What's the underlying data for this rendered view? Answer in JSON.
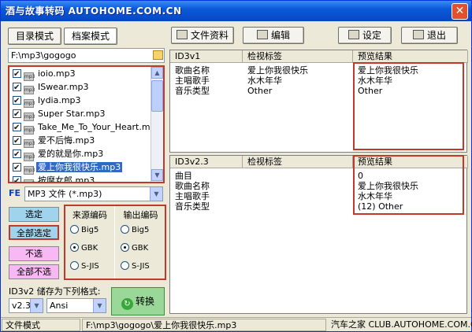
{
  "window": {
    "title": "酒与故事转码 AUTOHOME.COM.CN",
    "close_symbol": "✕"
  },
  "left_tabs": {
    "dir_mode": "目录模式",
    "file_mode": "档案模式"
  },
  "toolbar": {
    "file_info": "文件资料",
    "edit": "编辑",
    "settings": "设定",
    "exit": "退出"
  },
  "path": "F:\\mp3\\gogogo",
  "files": [
    "ioio.mp3",
    "ISwear.mp3",
    "lydia.mp3",
    "Super Star.mp3",
    "Take_Me_To_Your_Heart.mp3",
    "爱不后悔.mp3",
    "爱的就是你.mp3",
    "爱上你我很快乐.mp3",
    "按摩女郎.mp3"
  ],
  "selected_file_index": 7,
  "mp3_icon_text": "mp3",
  "filter": {
    "label": "FE",
    "value": "MP3 文件 (*.mp3)"
  },
  "actions": {
    "select": "选定",
    "select_all": "全部选定",
    "deselect": "不选",
    "deselect_all": "全部不选"
  },
  "encoding": {
    "source_title": "来源编码",
    "output_title": "输出编码",
    "options": [
      "Big5",
      "GBK",
      "S-JIS"
    ],
    "source_selected": "GBK",
    "output_selected": "GBK"
  },
  "store": {
    "label": "ID3v2 储存为下列格式:",
    "version": "v2.3",
    "charset": "Ansi",
    "convert": "转换"
  },
  "id3v1": {
    "headers": [
      "ID3v1",
      "检视标签",
      "预览结果"
    ],
    "rows": [
      [
        "歌曲名称",
        "爱上你我很快乐",
        "爱上你我很快乐"
      ],
      [
        "主唱歌手",
        "水木年华",
        "水木年华"
      ],
      [
        "音乐类型",
        "Other",
        "Other"
      ]
    ]
  },
  "id3v2": {
    "headers": [
      "ID3v2.3",
      "检视标签",
      "预览结果"
    ],
    "rows": [
      [
        "曲目",
        "",
        "0"
      ],
      [
        "歌曲名称",
        "",
        "爱上你我很快乐"
      ],
      [
        "主唱歌手",
        "",
        "水木年华"
      ],
      [
        "音乐类型",
        "",
        "(12) Other"
      ]
    ]
  },
  "statusbar": {
    "mode": "文件模式",
    "path": "F:\\mp3\\gogogo\\爱上你我很快乐.mp3",
    "brand": "汽车之家 CLUB.AUTOHOME.COM.CN"
  },
  "colors": {
    "title_bar": "#0a5ad8",
    "highlight": "#316ac5",
    "red_frame": "#c0392b",
    "select_btn": "#9fd4ec",
    "deselect_btn": "#f7b8f3",
    "convert_btn": "#99d898"
  }
}
